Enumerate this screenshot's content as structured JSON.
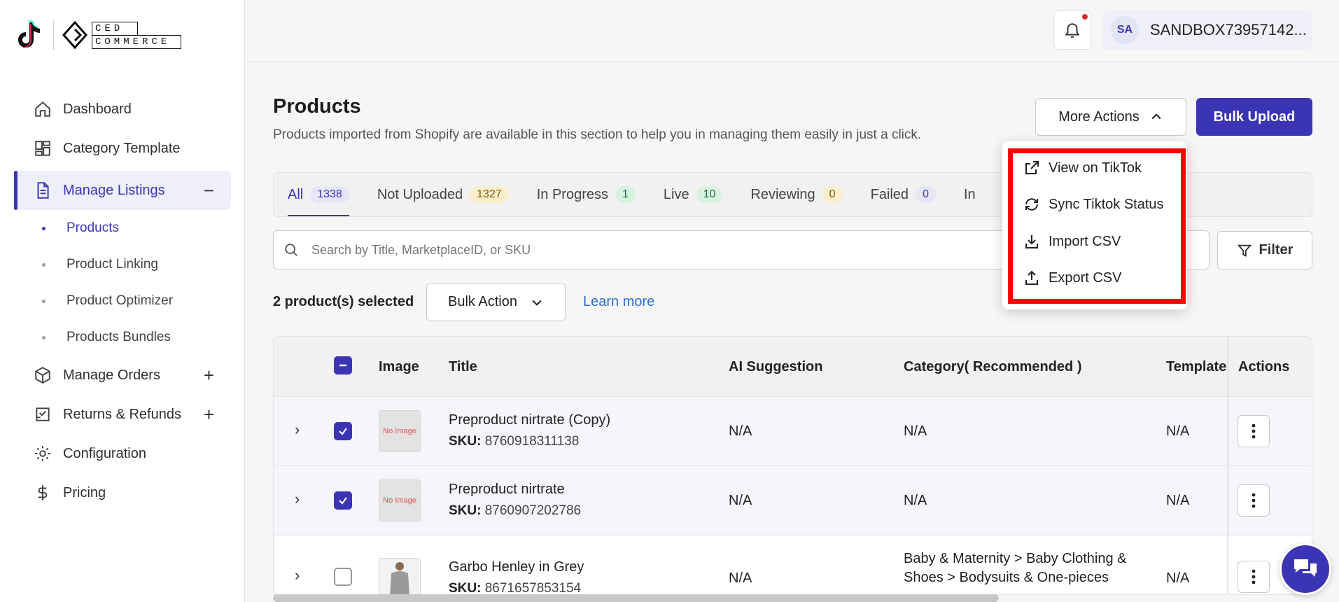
{
  "brand": {
    "ced_top": "CED",
    "ced_bottom": "COMMERCE"
  },
  "sidebar": {
    "items": [
      {
        "label": "Dashboard"
      },
      {
        "label": "Category Template"
      },
      {
        "label": "Manage Listings",
        "toggle": "−"
      },
      {
        "label": "Manage Orders",
        "toggle": "+"
      },
      {
        "label": "Returns & Refunds",
        "toggle": "+"
      },
      {
        "label": "Configuration"
      },
      {
        "label": "Pricing"
      }
    ],
    "sub_items": [
      {
        "label": "Products"
      },
      {
        "label": "Product Linking"
      },
      {
        "label": "Product Optimizer"
      },
      {
        "label": "Products Bundles"
      }
    ]
  },
  "topbar": {
    "avatar_initials": "SA",
    "user_name": "SANDBOX73957142..."
  },
  "page": {
    "title": "Products",
    "subtitle": "Products imported from Shopify are available in this section to help you in managing them easily in just a click.",
    "more_actions_label": "More Actions",
    "bulk_upload_label": "Bulk Upload"
  },
  "tabs": [
    {
      "label": "All",
      "count": "1338"
    },
    {
      "label": "Not Uploaded",
      "count": "1327"
    },
    {
      "label": "In Progress",
      "count": "1"
    },
    {
      "label": "Live",
      "count": "10"
    },
    {
      "label": "Reviewing",
      "count": "0"
    },
    {
      "label": "Failed",
      "count": "0"
    },
    {
      "label": "In"
    }
  ],
  "search": {
    "placeholder": "Search by Title, MarketplaceID, or SKU"
  },
  "filter_label": "Filter",
  "selection": {
    "text": "2 product(s) selected",
    "bulk_action_label": "Bulk Action",
    "learn_more": "Learn more"
  },
  "table": {
    "headers": {
      "image": "Image",
      "title": "Title",
      "ai": "AI Suggestion",
      "category": "Category( Recommended )",
      "template": "Template",
      "actions": "Actions"
    },
    "sku_label": "SKU:",
    "rows": [
      {
        "title": "Preproduct nirtrate (Copy)",
        "sku": "8760918311138",
        "image": "No Image",
        "ai": "N/A",
        "category": "N/A",
        "template": "N/A",
        "checked": true
      },
      {
        "title": "Preproduct nirtrate",
        "sku": "8760907202786",
        "image": "No Image",
        "ai": "N/A",
        "category": "N/A",
        "template": "N/A",
        "checked": true
      },
      {
        "title": "Garbo Henley in Grey",
        "sku": "8671657853154",
        "image": "",
        "ai": "N/A",
        "category": "Baby & Maternity > Baby Clothing & Shoes > Bodysuits & One-pieces",
        "template": "N/A",
        "checked": false
      }
    ]
  },
  "more_actions_menu": [
    {
      "label": "View on TikTok",
      "icon": "external-link-icon"
    },
    {
      "label": "Sync Tiktok Status",
      "icon": "sync-icon"
    },
    {
      "label": "Import CSV",
      "icon": "download-icon"
    },
    {
      "label": "Export CSV",
      "icon": "upload-icon"
    }
  ],
  "colors": {
    "primary": "#3b35b5",
    "highlight": "#ff0000",
    "link": "#2c6ecb"
  }
}
